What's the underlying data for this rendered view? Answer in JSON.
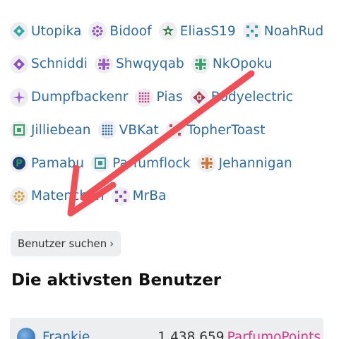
{
  "users": {
    "rows": [
      [
        {
          "name": "Utopika",
          "icon": "teal-diamond-icon",
          "color": "#2fa8a8"
        },
        {
          "name": "Bidoof",
          "icon": "purple-ring-icon",
          "color": "#8a4fc0"
        },
        {
          "name": "EliasS19",
          "icon": "green-star-icon",
          "color": "#2e7a3e"
        },
        {
          "name": "NoahRud",
          "icon": "teal-grid-icon",
          "color": "#3a9a9a"
        }
      ],
      [
        {
          "name": "Schniddi",
          "icon": "purple-diamond-icon",
          "color": "#8a4fc0"
        },
        {
          "name": "Shwqyqab",
          "icon": "purple-cross-icon",
          "color": "#9a5ad0"
        },
        {
          "name": "NkOpoku",
          "icon": "green-cross-icon",
          "color": "#3aa36a"
        }
      ],
      [
        {
          "name": "Dumpfbackenr",
          "icon": "purple-spark-icon",
          "color": "#9a5ad0"
        },
        {
          "name": "Pias",
          "icon": "pink-dots-icon",
          "color": "#d04a8a"
        },
        {
          "name": "Bodyelectric",
          "icon": "red-flower-icon",
          "color": "#b03a50"
        }
      ],
      [
        {
          "name": "Jilliebean",
          "icon": "green-square-icon",
          "color": "#3aa36a"
        },
        {
          "name": "VBKat",
          "icon": "blue-dots-icon",
          "color": "#2e6aa3"
        },
        {
          "name": "TopherToast",
          "icon": "red-grid-icon",
          "color": "#c04a5a"
        }
      ],
      [
        {
          "name": "Pamabu",
          "icon": "green-p-icon",
          "color": "#2e9a6a"
        },
        {
          "name": "Parfumflock",
          "icon": "teal-square-icon",
          "color": "#3a9a9a"
        },
        {
          "name": "Jehannigan",
          "icon": "orange-cross-icon",
          "color": "#d07a3a"
        }
      ],
      [
        {
          "name": "Matenchen",
          "icon": "orange-ring-icon",
          "color": "#d0a03a"
        },
        {
          "name": "MrBa",
          "icon": "purple-grid-icon",
          "color": "#8a4fc0"
        }
      ]
    ]
  },
  "search_button": {
    "label": "Benutzer suchen",
    "chevron": "›"
  },
  "section": {
    "title": "Die aktivsten Benutzer"
  },
  "ranking": {
    "first": {
      "name": "Frankie",
      "points": "1.438.659",
      "unit": "ParfumoPoints"
    }
  },
  "colors": {
    "link": "#2e6aa3",
    "accent": "#d63b8a",
    "arrow": "#ef4f55"
  }
}
